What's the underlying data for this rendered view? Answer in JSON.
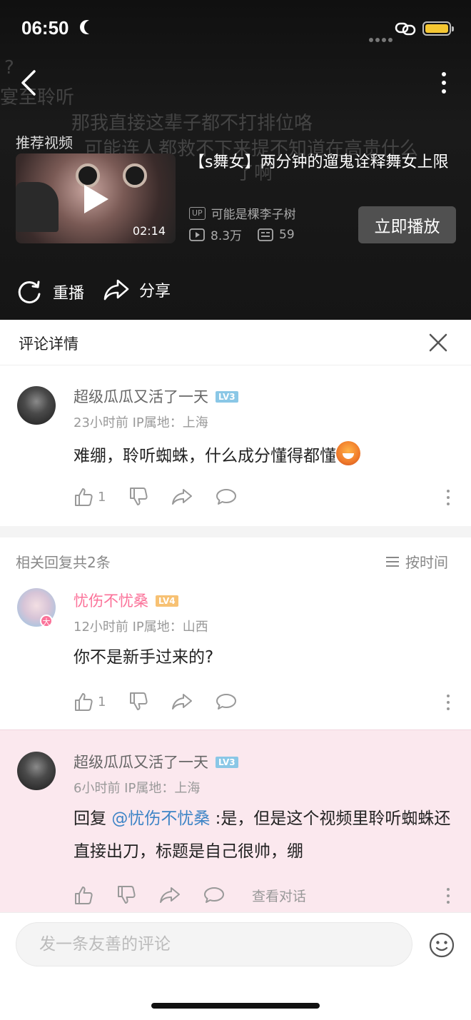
{
  "status_bar": {
    "time": "06:50"
  },
  "video": {
    "danmaku": [
      "?",
      "宴至聆听",
      "那我直接这辈子都不打排位咯",
      "可能连人都救不下来提不知道在高贵什么",
      "了啊"
    ],
    "recommend_label": "推荐视频",
    "title": "【s舞女】两分钟的遛鬼诠释舞女上限",
    "duration": "02:14",
    "up_badge": "UP",
    "author": "可能是棵李子树",
    "views": "8.3万",
    "danmaku_count": "59",
    "play_now": "立即播放",
    "replay": "重播",
    "share": "分享"
  },
  "panel": {
    "title": "评论详情"
  },
  "main_comment": {
    "username": "超级瓜瓜又活了一天",
    "level": "LV3",
    "meta": "23小时前  IP属地：上海",
    "text": "难绷，聆听蜘蛛，什么成分懂得都懂",
    "likes": "1"
  },
  "replies": {
    "header": "相关回复共2条",
    "sort_label": "按时间"
  },
  "reply1": {
    "username": "忧伤不忧桑",
    "level": "LV4",
    "vip": "大",
    "meta": "12小时前  IP属地：山西",
    "text": "你不是新手过来的?",
    "likes": "1"
  },
  "reply2": {
    "username": "超级瓜瓜又活了一天",
    "level": "LV3",
    "meta": "6小时前  IP属地：上海",
    "reply_prefix": "回复 ",
    "mention": "@忧伤不忧桑",
    "text": " :是，但是这个视频里聆听蜘蛛还直接出刀，标题是自己很帅，绷",
    "view_conversation": "查看对话"
  },
  "input": {
    "placeholder": "发一条友善的评论"
  },
  "colors": {
    "accent_pink": "#fb7299",
    "mention_blue": "#3d84c6",
    "highlight_bg": "#fbe8ee"
  }
}
